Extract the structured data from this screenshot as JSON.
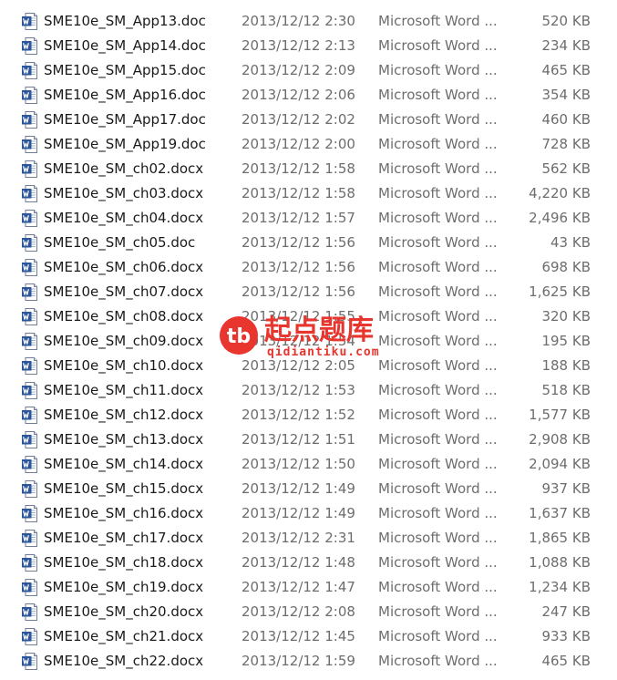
{
  "icon": "word-document-icon",
  "colors": {
    "word_icon_blue": "#2b579a",
    "secondary_text": "#6d6d6d",
    "watermark_red": "#e8352e"
  },
  "files": [
    {
      "name": "SME10e_SM_App13.doc",
      "date": "2013/12/12 2:30",
      "type": "Microsoft Word ...",
      "size": "520 KB"
    },
    {
      "name": "SME10e_SM_App14.doc",
      "date": "2013/12/12 2:13",
      "type": "Microsoft Word ...",
      "size": "234 KB"
    },
    {
      "name": "SME10e_SM_App15.doc",
      "date": "2013/12/12 2:09",
      "type": "Microsoft Word ...",
      "size": "465 KB"
    },
    {
      "name": "SME10e_SM_App16.doc",
      "date": "2013/12/12 2:06",
      "type": "Microsoft Word ...",
      "size": "354 KB"
    },
    {
      "name": "SME10e_SM_App17.doc",
      "date": "2013/12/12 2:02",
      "type": "Microsoft Word ...",
      "size": "460 KB"
    },
    {
      "name": "SME10e_SM_App19.doc",
      "date": "2013/12/12 2:00",
      "type": "Microsoft Word ...",
      "size": "728 KB"
    },
    {
      "name": "SME10e_SM_ch02.docx",
      "date": "2013/12/12 1:58",
      "type": "Microsoft Word ...",
      "size": "562 KB"
    },
    {
      "name": "SME10e_SM_ch03.docx",
      "date": "2013/12/12 1:58",
      "type": "Microsoft Word ...",
      "size": "4,220 KB"
    },
    {
      "name": "SME10e_SM_ch04.docx",
      "date": "2013/12/12 1:57",
      "type": "Microsoft Word ...",
      "size": "2,496 KB"
    },
    {
      "name": "SME10e_SM_ch05.doc",
      "date": "2013/12/12 1:56",
      "type": "Microsoft Word ...",
      "size": "43 KB"
    },
    {
      "name": "SME10e_SM_ch06.docx",
      "date": "2013/12/12 1:56",
      "type": "Microsoft Word ...",
      "size": "698 KB"
    },
    {
      "name": "SME10e_SM_ch07.docx",
      "date": "2013/12/12 1:56",
      "type": "Microsoft Word ...",
      "size": "1,625 KB"
    },
    {
      "name": "SME10e_SM_ch08.docx",
      "date": "2013/12/12 1:55",
      "type": "Microsoft Word ...",
      "size": "320 KB"
    },
    {
      "name": "SME10e_SM_ch09.docx",
      "date": "2013/12/12 1:54",
      "type": "Microsoft Word ...",
      "size": "195 KB"
    },
    {
      "name": "SME10e_SM_ch10.docx",
      "date": "2013/12/12 2:05",
      "type": "Microsoft Word ...",
      "size": "188 KB"
    },
    {
      "name": "SME10e_SM_ch11.docx",
      "date": "2013/12/12 1:53",
      "type": "Microsoft Word ...",
      "size": "518 KB"
    },
    {
      "name": "SME10e_SM_ch12.docx",
      "date": "2013/12/12 1:52",
      "type": "Microsoft Word ...",
      "size": "1,577 KB"
    },
    {
      "name": "SME10e_SM_ch13.docx",
      "date": "2013/12/12 1:51",
      "type": "Microsoft Word ...",
      "size": "2,908 KB"
    },
    {
      "name": "SME10e_SM_ch14.docx",
      "date": "2013/12/12 1:50",
      "type": "Microsoft Word ...",
      "size": "2,094 KB"
    },
    {
      "name": "SME10e_SM_ch15.docx",
      "date": "2013/12/12 1:49",
      "type": "Microsoft Word ...",
      "size": "937 KB"
    },
    {
      "name": "SME10e_SM_ch16.docx",
      "date": "2013/12/12 1:49",
      "type": "Microsoft Word ...",
      "size": "1,637 KB"
    },
    {
      "name": "SME10e_SM_ch17.docx",
      "date": "2013/12/12 2:31",
      "type": "Microsoft Word ...",
      "size": "1,865 KB"
    },
    {
      "name": "SME10e_SM_ch18.docx",
      "date": "2013/12/12 1:48",
      "type": "Microsoft Word ...",
      "size": "1,088 KB"
    },
    {
      "name": "SME10e_SM_ch19.docx",
      "date": "2013/12/12 1:47",
      "type": "Microsoft Word ...",
      "size": "1,234 KB"
    },
    {
      "name": "SME10e_SM_ch20.docx",
      "date": "2013/12/12 2:08",
      "type": "Microsoft Word ...",
      "size": "247 KB"
    },
    {
      "name": "SME10e_SM_ch21.docx",
      "date": "2013/12/12 1:45",
      "type": "Microsoft Word ...",
      "size": "933 KB"
    },
    {
      "name": "SME10e_SM_ch22.docx",
      "date": "2013/12/12 1:59",
      "type": "Microsoft Word ...",
      "size": "465 KB"
    }
  ],
  "watermark": {
    "badge": "tb",
    "title": "起点题库",
    "url": "qidiantiku.com"
  }
}
